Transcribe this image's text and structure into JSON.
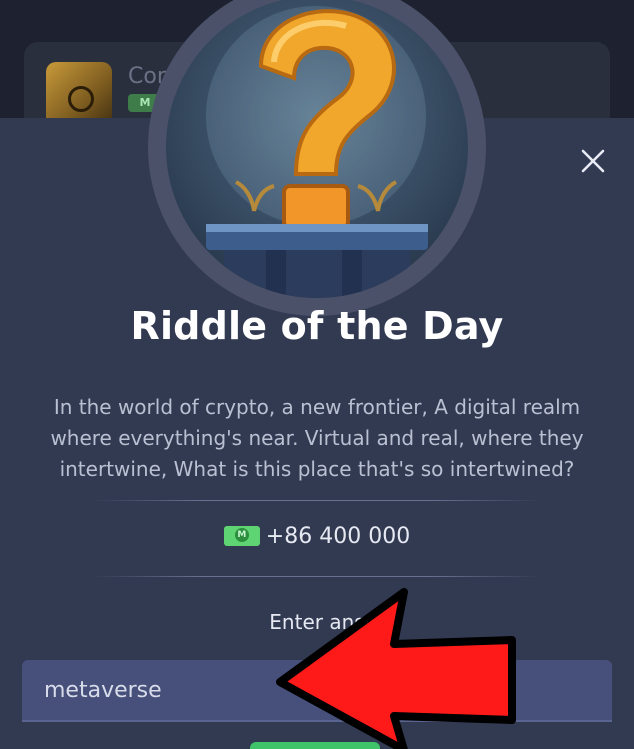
{
  "background": {
    "card_title": "Com",
    "card_badge": "M"
  },
  "modal": {
    "title": "Riddle of the Day",
    "riddle_text": "In the world of crypto, a new frontier, A digital realm where everything's near. Virtual and real, where they intertwine, What is this place that's so intertwined?",
    "reward_text": "+86 400 000",
    "enter_label": "Enter ans",
    "answer_value": "metaverse",
    "close_icon": "close-icon"
  },
  "colors": {
    "modal_bg": "#323a52",
    "input_bg": "#46507a",
    "accent_green": "#5fd472",
    "arrow_red": "#ff1a1a"
  }
}
